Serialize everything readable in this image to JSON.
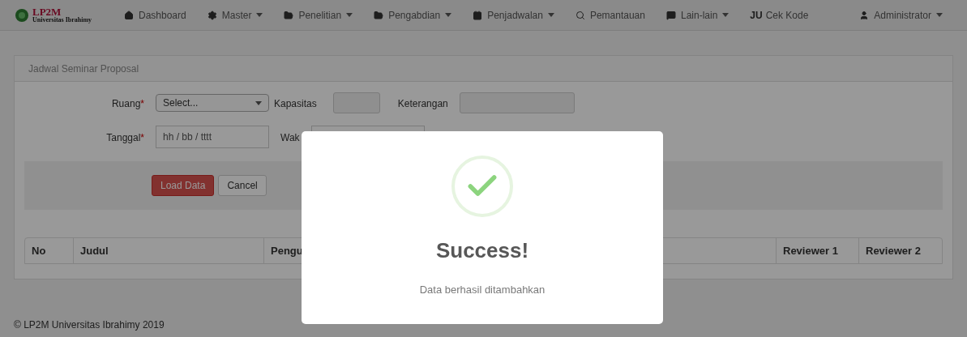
{
  "navbar": {
    "brand": {
      "title": "LP2M",
      "subtitle": "Universitas Ibrahimy"
    },
    "items": [
      {
        "label": "Dashboard",
        "dropdown": false
      },
      {
        "label": "Master",
        "dropdown": true
      },
      {
        "label": "Penelitian",
        "dropdown": true
      },
      {
        "label": "Pengabdian",
        "dropdown": true
      },
      {
        "label": "Penjadwalan",
        "dropdown": true
      },
      {
        "label": "Pemantauan",
        "dropdown": false
      },
      {
        "label": "Lain-lain",
        "dropdown": true
      },
      {
        "label": "Cek Kode",
        "glyph": "JU",
        "dropdown": false
      }
    ],
    "user": {
      "label": "Administrator",
      "dropdown": true
    }
  },
  "panel": {
    "title": "Jadwal Seminar Proposal",
    "form": {
      "ruang": {
        "label": "Ruang",
        "marker": "*",
        "value": "Select..."
      },
      "kapasitas": {
        "label": "Kapasitas"
      },
      "keterangan": {
        "label": "Keterangan"
      },
      "tanggal": {
        "label": "Tanggal",
        "marker": "*",
        "value": "hh / bb / tttt"
      },
      "waktu": {
        "label": "Wak"
      }
    },
    "buttons": [
      {
        "label": "Load Data",
        "kind": "primary"
      },
      {
        "label": "Cancel",
        "kind": "default"
      }
    ],
    "table": {
      "columns": [
        "No",
        "Judul",
        "Pengu",
        "Reviewer 1",
        "Reviewer 2"
      ]
    }
  },
  "footer": "© LP2M Universitas Ibrahimy 2019",
  "modal": {
    "title": "Success!",
    "message": "Data berhasil ditambahkan"
  }
}
